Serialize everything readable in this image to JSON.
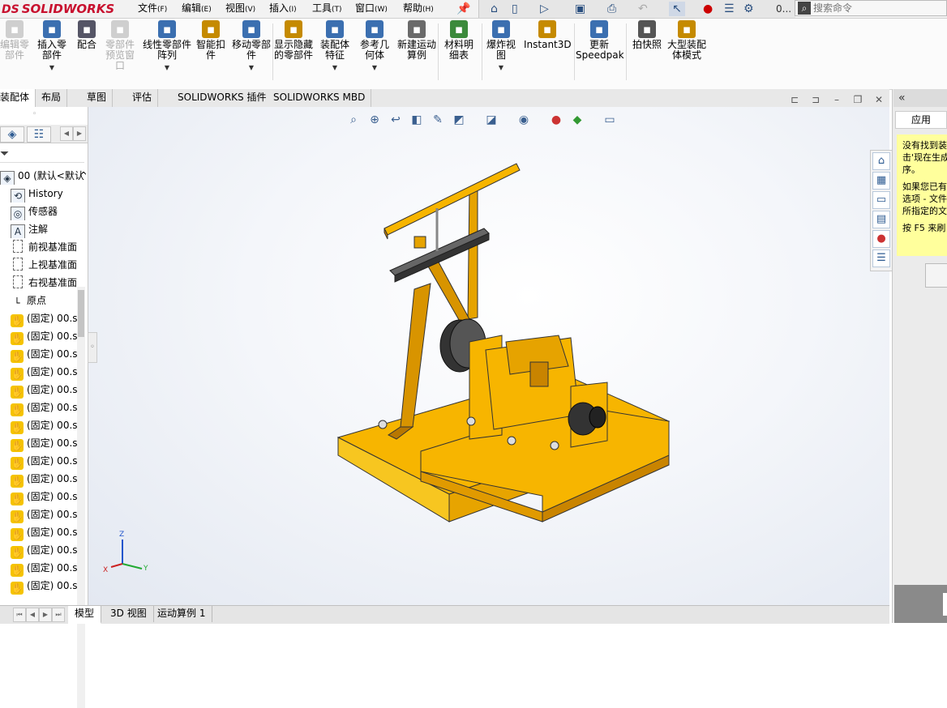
{
  "app": {
    "brand": "SOLIDWORKS",
    "brand_prefix": "DS"
  },
  "menus": [
    {
      "label": "文件",
      "key": "(F)"
    },
    {
      "label": "编辑",
      "key": "(E)"
    },
    {
      "label": "视图",
      "key": "(V)"
    },
    {
      "label": "插入",
      "key": "(I)"
    },
    {
      "label": "工具",
      "key": "(T)"
    },
    {
      "label": "窗口",
      "key": "(W)"
    },
    {
      "label": "帮助",
      "key": "(H)"
    }
  ],
  "quick_access": {
    "zoom_text": "0...",
    "icons": [
      "pin-icon",
      "home-icon",
      "new-doc-icon",
      "open-icon",
      "save-icon",
      "print-icon",
      "undo-icon",
      "select-icon",
      "traffic-light-icon",
      "file-props-icon",
      "options-gear-icon"
    ]
  },
  "search": {
    "placeholder": "搜索命令"
  },
  "ribbon": {
    "buttons": [
      {
        "label": "编辑零部件",
        "icon": "edit-component-icon",
        "disabled": true
      },
      {
        "label": "插入零部件",
        "icon": "insert-component-icon",
        "disabled": false
      },
      {
        "label": "配合",
        "icon": "mate-icon",
        "disabled": false
      },
      {
        "label": "零部件预览窗口",
        "icon": "component-preview-icon",
        "disabled": true
      },
      {
        "label": "线性零部件阵列",
        "icon": "linear-pattern-icon",
        "disabled": false
      },
      {
        "label": "智能扣件",
        "icon": "smart-fastener-icon",
        "disabled": false
      },
      {
        "label": "移动零部件",
        "icon": "move-component-icon",
        "disabled": false
      },
      {
        "label": "显示隐藏的零部件",
        "icon": "show-hidden-icon",
        "disabled": false
      },
      {
        "label": "装配体特征",
        "icon": "assembly-feature-icon",
        "disabled": false
      },
      {
        "label": "参考几何体",
        "icon": "reference-geometry-icon",
        "disabled": false
      },
      {
        "label": "新建运动算例",
        "icon": "motion-study-icon",
        "disabled": false
      },
      {
        "label": "材料明细表",
        "icon": "bom-icon",
        "disabled": false
      },
      {
        "label": "爆炸视图",
        "icon": "exploded-view-icon",
        "disabled": false
      },
      {
        "label": "Instant3D",
        "icon": "instant3d-icon",
        "disabled": false
      },
      {
        "label": "更新Speedpak",
        "icon": "speedpak-icon",
        "disabled": false
      },
      {
        "label": "拍快照",
        "icon": "snapshot-icon",
        "disabled": false
      },
      {
        "label": "大型装配体模式",
        "icon": "large-assembly-icon",
        "disabled": false
      }
    ]
  },
  "tabs": [
    "装配体",
    "布局",
    "草图",
    "评估",
    "SOLIDWORKS 插件",
    "SOLIDWORKS MBD"
  ],
  "active_tab": "装配体",
  "tree": {
    "root": "00 (默认<默认",
    "items": [
      {
        "label": "History",
        "icon": "history-icon"
      },
      {
        "label": "传感器",
        "icon": "sensor-icon"
      },
      {
        "label": "注解",
        "icon": "annotation-icon"
      },
      {
        "label": "前视基准面",
        "icon": "plane-icon"
      },
      {
        "label": "上视基准面",
        "icon": "plane-icon"
      },
      {
        "label": "右视基准面",
        "icon": "plane-icon"
      },
      {
        "label": "原点",
        "icon": "origin-icon"
      }
    ],
    "part_label": "(固定) 00.s",
    "part_count": 16
  },
  "bottom_tabs": [
    "模型",
    "3D 视图",
    "运动算例 1"
  ],
  "active_bottom_tab": "模型",
  "task_pane": {
    "apply_label": "应用",
    "note_lines": [
      "没有找到装",
      "击'现在生成",
      "序。"
    ],
    "note_lines2": [
      "如果您已有",
      "选项 - 文件",
      "所指定的文"
    ],
    "note_line3": "按 F5 来刷",
    "icons": [
      "home-icon",
      "parts-library-icon",
      "file-explorer-icon",
      "view-palette-icon",
      "appearances-icon",
      "custom-props-icon"
    ]
  },
  "triad": {
    "x": "X",
    "y": "Y",
    "z": "Z"
  },
  "colors": {
    "part_yellow": "#f7b500",
    "part_dark": "#d48a00",
    "accent_blue": "#2d5b92",
    "note_yellow": "#ffff9c"
  }
}
